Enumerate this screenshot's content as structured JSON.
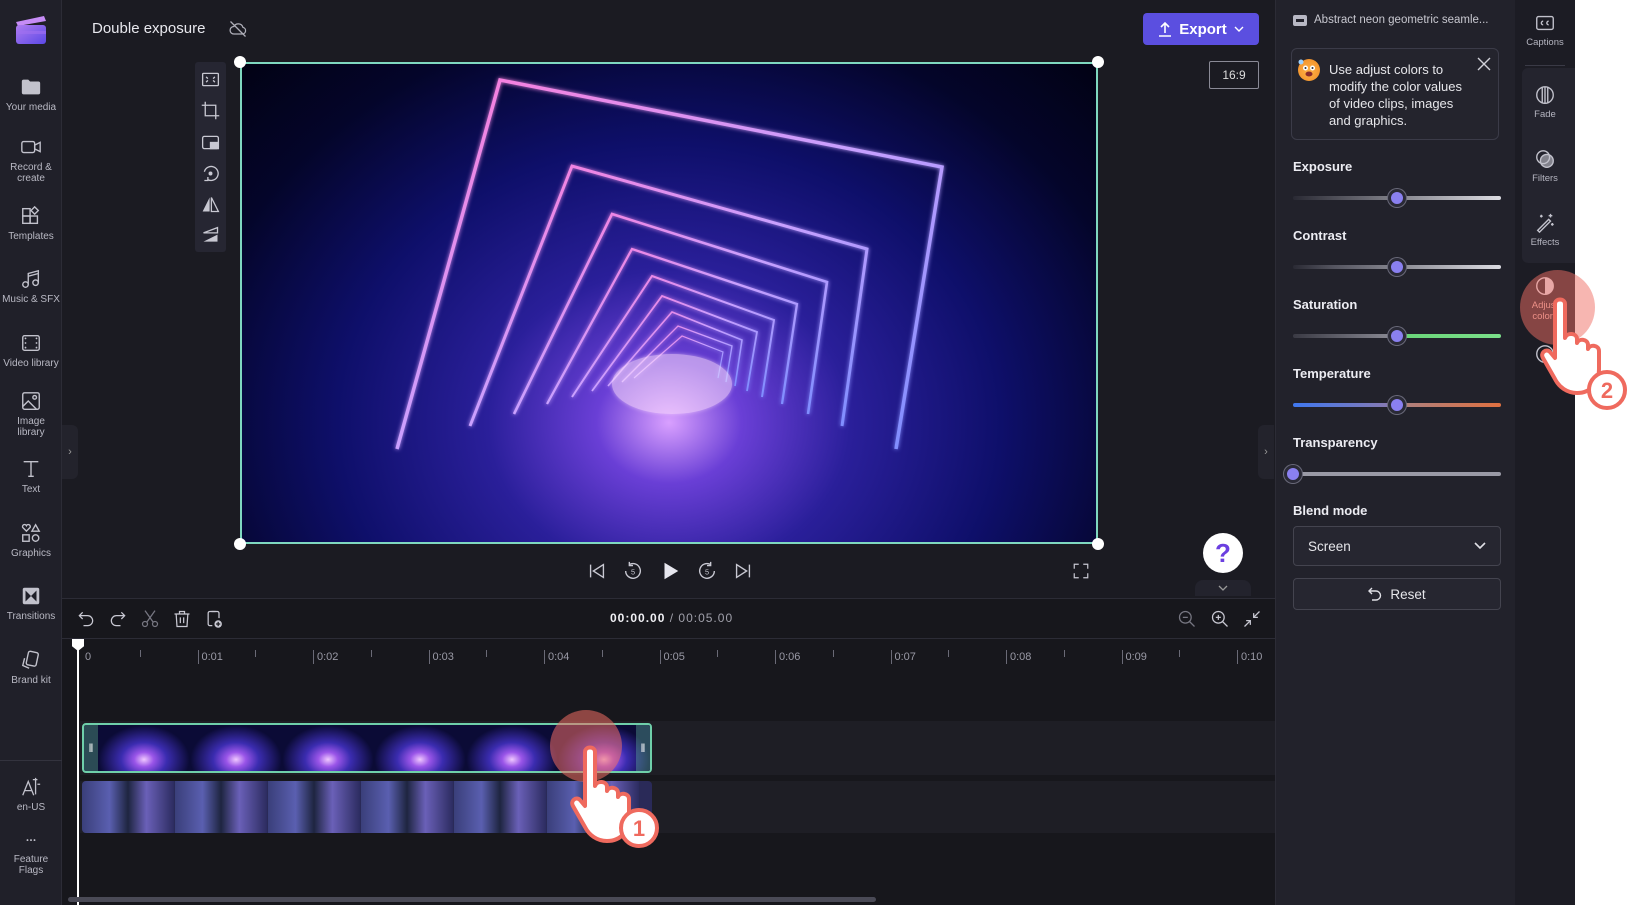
{
  "app": {
    "project_title": "Double exposure",
    "brand_color": "#5b4fe0"
  },
  "left_nav": {
    "items": [
      {
        "id": "your-media",
        "label": "Your media",
        "icon": "folder-icon"
      },
      {
        "id": "record-create",
        "label": "Record & create",
        "icon": "video-camera-icon"
      },
      {
        "id": "templates",
        "label": "Templates",
        "icon": "templates-icon"
      },
      {
        "id": "music-sfx",
        "label": "Music & SFX",
        "icon": "music-icon"
      },
      {
        "id": "video-library",
        "label": "Video library",
        "icon": "film-icon"
      },
      {
        "id": "image-library",
        "label": "Image library",
        "icon": "image-icon"
      },
      {
        "id": "text",
        "label": "Text",
        "icon": "text-icon"
      },
      {
        "id": "graphics",
        "label": "Graphics",
        "icon": "shapes-icon"
      },
      {
        "id": "transitions",
        "label": "Transitions",
        "icon": "transitions-icon"
      },
      {
        "id": "brand-kit",
        "label": "Brand kit",
        "icon": "brand-kit-icon"
      }
    ],
    "bottom": [
      {
        "id": "language",
        "label": "en-US",
        "icon": "language-icon"
      },
      {
        "id": "feature-flags",
        "label": "Feature Flags",
        "icon": "more-icon"
      }
    ]
  },
  "header": {
    "export_label": "Export",
    "aspect_ratio": "16:9"
  },
  "preview_tools": [
    "fit-icon",
    "crop-icon",
    "pip-icon",
    "rotate-icon",
    "flip-horizontal-icon",
    "flip-vertical-icon"
  ],
  "playback": {
    "current_time": "00:00.00",
    "separator": "/",
    "total_time": "00:05.00",
    "help_label": "?"
  },
  "timeline": {
    "ruler": [
      "0",
      "0:01",
      "0:02",
      "0:03",
      "0:04",
      "0:05",
      "0:06",
      "0:07",
      "0:08",
      "0:09",
      "0:10"
    ],
    "tracks": [
      {
        "name": "neon-geometric-clip",
        "selected": true
      },
      {
        "name": "person-room-clip",
        "selected": false
      }
    ]
  },
  "properties": {
    "clip_name": "Abstract neon geometric seamle...",
    "tip": "Use adjust colors to modify the color values of video clips, images and graphics.",
    "sliders": [
      {
        "label": "Exposure",
        "value": 0.5
      },
      {
        "label": "Contrast",
        "value": 0.5
      },
      {
        "label": "Saturation",
        "value": 0.5
      },
      {
        "label": "Temperature",
        "value": 0.5
      },
      {
        "label": "Transparency",
        "value": 0.0
      }
    ],
    "blend_mode_label": "Blend mode",
    "blend_mode_value": "Screen",
    "reset_label": "Reset"
  },
  "right_rail": {
    "items": [
      {
        "id": "captions",
        "label": "Captions",
        "icon": "captions-icon"
      },
      {
        "id": "fade",
        "label": "Fade",
        "icon": "fade-icon"
      },
      {
        "id": "filters",
        "label": "Filters",
        "icon": "filters-icon"
      },
      {
        "id": "effects",
        "label": "Effects",
        "icon": "effects-icon"
      },
      {
        "id": "adjust-colors",
        "label": "Adjust colors",
        "icon": "adjust-colors-icon"
      }
    ]
  },
  "tutorial": {
    "step1": "1",
    "step2": "2"
  }
}
